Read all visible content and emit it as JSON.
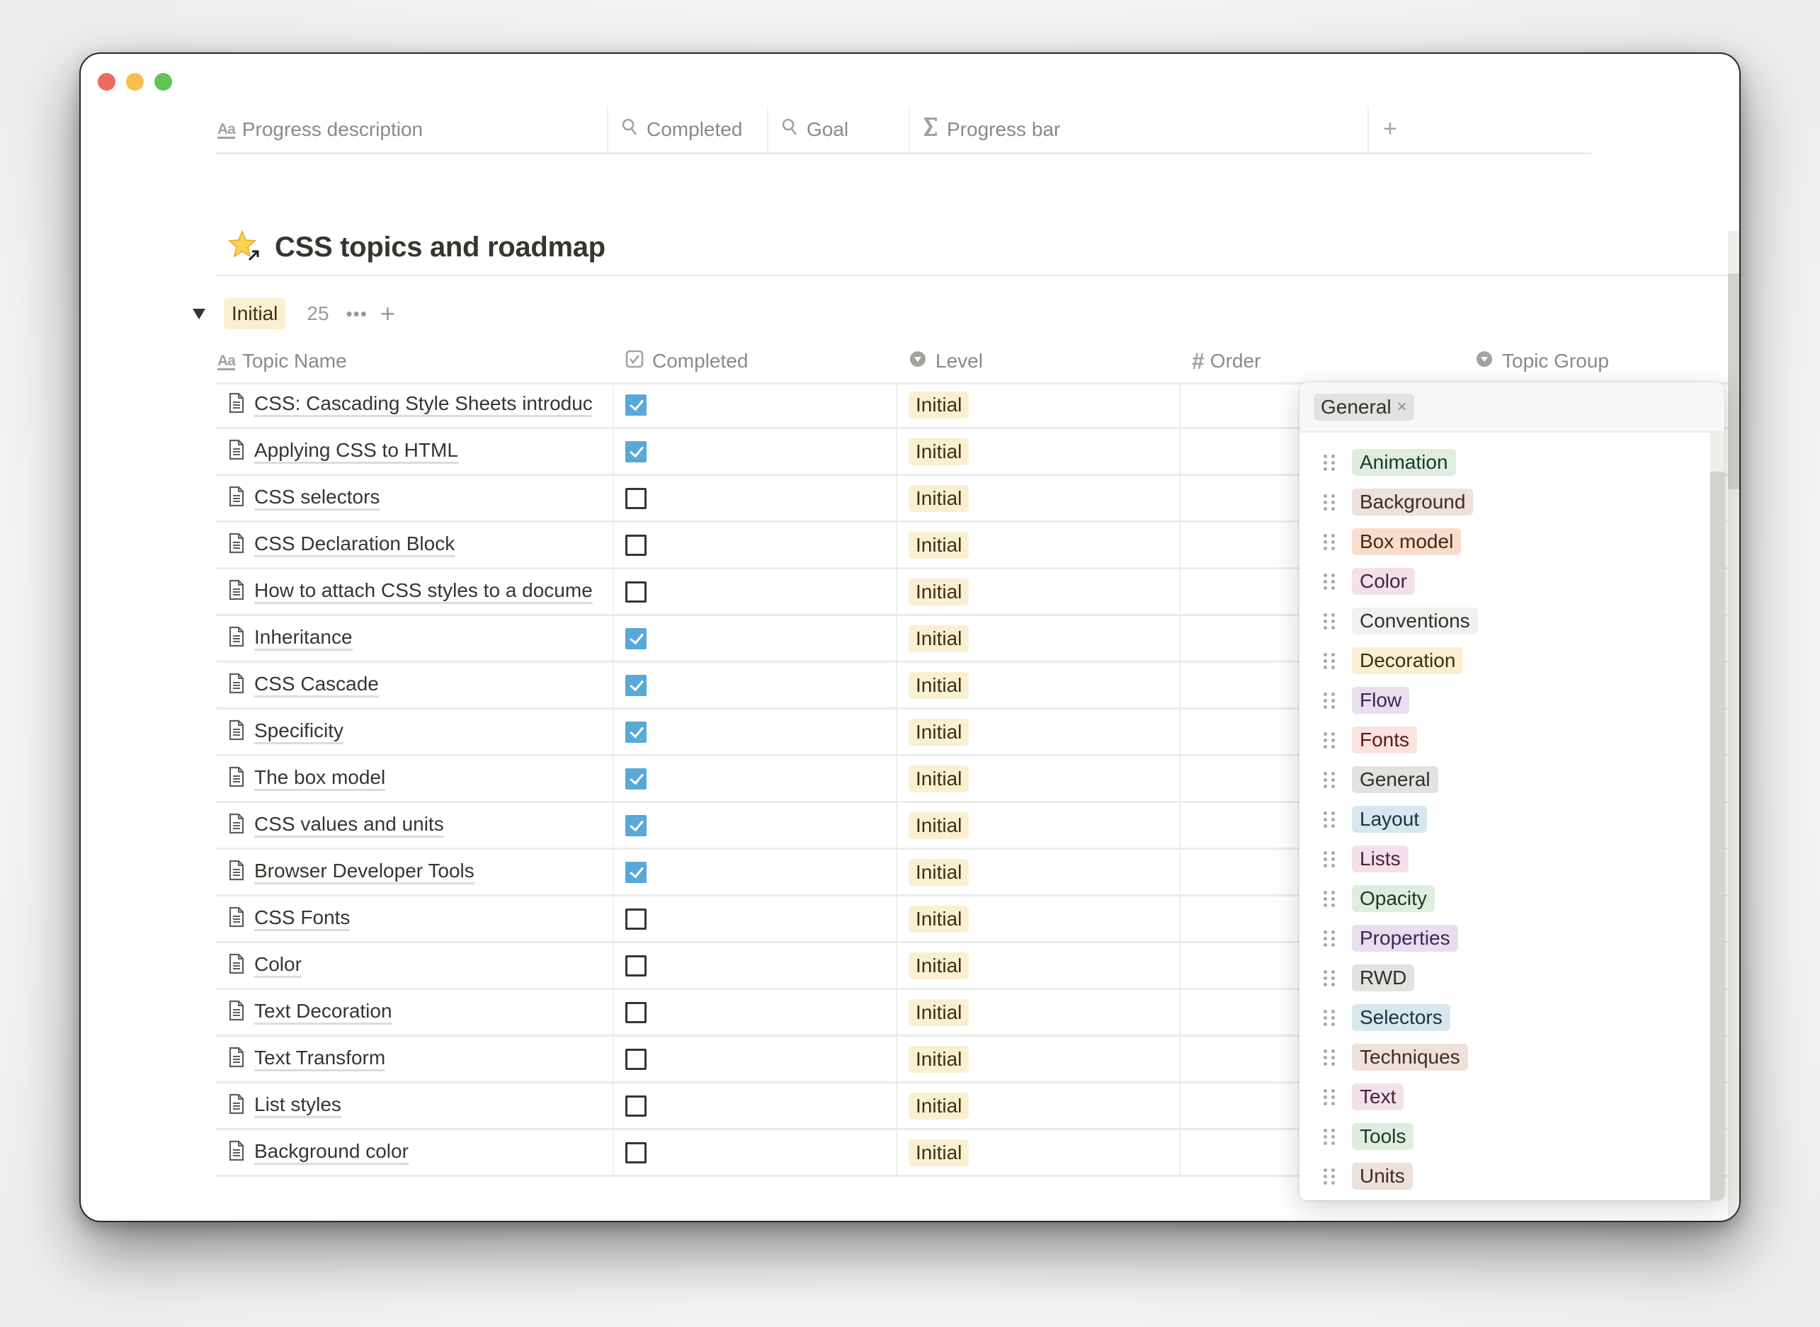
{
  "window": {
    "traffic_lights": [
      "close",
      "minimize",
      "zoom"
    ]
  },
  "top_header": {
    "columns": [
      {
        "icon": "text-icon",
        "icon_text": "Aa",
        "label": "Progress description"
      },
      {
        "icon": "search-icon",
        "label": "Completed"
      },
      {
        "icon": "search-icon",
        "label": "Goal"
      },
      {
        "icon": "sigma-icon",
        "label": "Progress bar"
      }
    ],
    "add_label": "+"
  },
  "page": {
    "title_icon": "star-link-icon",
    "title": "CSS topics and roadmap"
  },
  "group": {
    "label": "Initial",
    "count": "25",
    "more_label": "•••",
    "add_label": "+"
  },
  "table": {
    "columns": [
      {
        "icon": "text-icon",
        "icon_text": "Aa",
        "label": "Topic Name"
      },
      {
        "icon": "checkbox-icon",
        "label": "Completed"
      },
      {
        "icon": "select-icon",
        "label": "Level"
      },
      {
        "icon": "number-icon",
        "icon_text": "#",
        "label": "Order"
      },
      {
        "icon": "select-icon",
        "label": "Topic Group"
      }
    ],
    "rows": [
      {
        "name": "CSS: Cascading Style Sheets introduc",
        "completed": true,
        "level": "Initial"
      },
      {
        "name": "Applying CSS to HTML",
        "completed": true,
        "level": "Initial"
      },
      {
        "name": "CSS selectors",
        "completed": false,
        "level": "Initial"
      },
      {
        "name": "CSS Declaration Block",
        "completed": false,
        "level": "Initial"
      },
      {
        "name": "How to attach CSS styles to a docume",
        "completed": false,
        "level": "Initial"
      },
      {
        "name": "Inheritance",
        "completed": true,
        "level": "Initial"
      },
      {
        "name": "CSS Cascade",
        "completed": true,
        "level": "Initial"
      },
      {
        "name": "Specificity",
        "completed": true,
        "level": "Initial"
      },
      {
        "name": "The box model",
        "completed": true,
        "level": "Initial"
      },
      {
        "name": "CSS values and units",
        "completed": true,
        "level": "Initial"
      },
      {
        "name": "Browser Developer Tools",
        "completed": true,
        "level": "Initial"
      },
      {
        "name": "CSS Fonts",
        "completed": false,
        "level": "Initial"
      },
      {
        "name": "Color",
        "completed": false,
        "level": "Initial"
      },
      {
        "name": "Text Decoration",
        "completed": false,
        "level": "Initial"
      },
      {
        "name": "Text Transform",
        "completed": false,
        "level": "Initial"
      },
      {
        "name": "List styles",
        "completed": false,
        "level": "Initial"
      },
      {
        "name": "Background color",
        "completed": false,
        "level": "Initial"
      }
    ]
  },
  "colors": {
    "checkbox_checked": "#58a8d8",
    "level_initial_bg": "#fbefd1",
    "level_initial_text": "#3d2f13",
    "text_primary": "#37352f",
    "text_muted": "#8b8a87"
  },
  "topic_group_popup": {
    "selected_chip": {
      "label": "General",
      "remove_icon": "×",
      "bg": "#e3e2e0"
    },
    "options": [
      {
        "label": "Animation",
        "bg": "#dfeddf",
        "fg": "#1c3829"
      },
      {
        "label": "Background",
        "bg": "#eee0da",
        "fg": "#3f2c23"
      },
      {
        "label": "Box model",
        "bg": "#f8ddcc",
        "fg": "#44291a"
      },
      {
        "label": "Color",
        "bg": "#f2e1e9",
        "fg": "#4c2337"
      },
      {
        "label": "Conventions",
        "bg": "#f1f1ef",
        "fg": "#32302c"
      },
      {
        "label": "Decoration",
        "bg": "#fbefd1",
        "fg": "#3d2f13"
      },
      {
        "label": "Flow",
        "bg": "#e8deee",
        "fg": "#412454"
      },
      {
        "label": "Fonts",
        "bg": "#fbe3e0",
        "fg": "#5d1715"
      },
      {
        "label": "General",
        "bg": "#e3e2e0",
        "fg": "#32302c"
      },
      {
        "label": "Layout",
        "bg": "#d8e6ee",
        "fg": "#183347"
      },
      {
        "label": "Lists",
        "bg": "#f2e1e9",
        "fg": "#4c2337"
      },
      {
        "label": "Opacity",
        "bg": "#dfeddf",
        "fg": "#1c3829"
      },
      {
        "label": "Properties",
        "bg": "#e8deee",
        "fg": "#412454"
      },
      {
        "label": "RWD",
        "bg": "#e3e2e0",
        "fg": "#32302c"
      },
      {
        "label": "Selectors",
        "bg": "#d8e6ee",
        "fg": "#183347"
      },
      {
        "label": "Techniques",
        "bg": "#eee0da",
        "fg": "#3f2c23"
      },
      {
        "label": "Text",
        "bg": "#f2e1e9",
        "fg": "#4c2337"
      },
      {
        "label": "Tools",
        "bg": "#dfeddf",
        "fg": "#1c3829"
      },
      {
        "label": "Units",
        "bg": "#eee0da",
        "fg": "#3f2c23"
      }
    ]
  }
}
